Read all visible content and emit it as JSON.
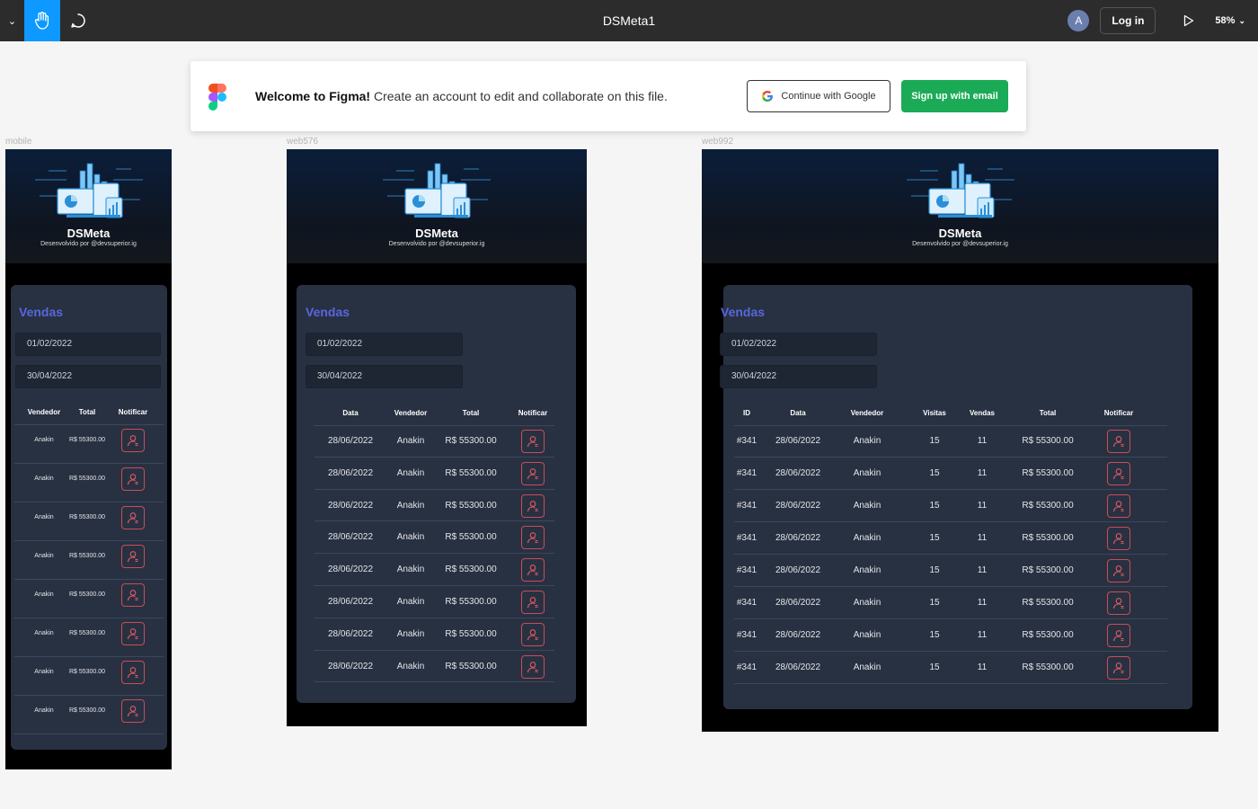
{
  "toolbar": {
    "title": "DSMeta1",
    "avatar_letter": "A",
    "login_label": "Log in",
    "zoom": "58%"
  },
  "banner": {
    "welcome_bold": "Welcome to Figma!",
    "welcome_text": " Create an account to edit and collaborate on this file.",
    "google_label": "Continue with Google",
    "email_label": "Sign up with email"
  },
  "frames": {
    "mobile": {
      "label": "mobile"
    },
    "web576": {
      "label": "web576"
    },
    "web992": {
      "label": "web992"
    }
  },
  "app": {
    "brand": "DSMeta",
    "developer": "Desenvolvido por @devsuperior.ig",
    "section_title": "Vendas",
    "date_min": "01/02/2022",
    "date_max": "30/04/2022",
    "headers": {
      "id": "ID",
      "date": "Data",
      "seller": "Vendedor",
      "visits": "Visitas",
      "deals": "Vendas",
      "amount": "Total",
      "notify": "Notificar"
    }
  },
  "sales": [
    {
      "id": "#341",
      "date": "28/06/2022",
      "seller": "Anakin",
      "visits": "15",
      "deals": "11",
      "amount": "R$ 55300.00"
    },
    {
      "id": "#341",
      "date": "28/06/2022",
      "seller": "Anakin",
      "visits": "15",
      "deals": "11",
      "amount": "R$ 55300.00"
    },
    {
      "id": "#341",
      "date": "28/06/2022",
      "seller": "Anakin",
      "visits": "15",
      "deals": "11",
      "amount": "R$ 55300.00"
    },
    {
      "id": "#341",
      "date": "28/06/2022",
      "seller": "Anakin",
      "visits": "15",
      "deals": "11",
      "amount": "R$ 55300.00"
    },
    {
      "id": "#341",
      "date": "28/06/2022",
      "seller": "Anakin",
      "visits": "15",
      "deals": "11",
      "amount": "R$ 55300.00"
    },
    {
      "id": "#341",
      "date": "28/06/2022",
      "seller": "Anakin",
      "visits": "15",
      "deals": "11",
      "amount": "R$ 55300.00"
    },
    {
      "id": "#341",
      "date": "28/06/2022",
      "seller": "Anakin",
      "visits": "15",
      "deals": "11",
      "amount": "R$ 55300.00"
    },
    {
      "id": "#341",
      "date": "28/06/2022",
      "seller": "Anakin",
      "visits": "15",
      "deals": "11",
      "amount": "R$ 55300.00"
    }
  ],
  "colors": {
    "accent": "#0d99ff",
    "signup": "#1bab56",
    "card": "#283142",
    "title": "#5867dd",
    "notify": "#c94d56"
  }
}
